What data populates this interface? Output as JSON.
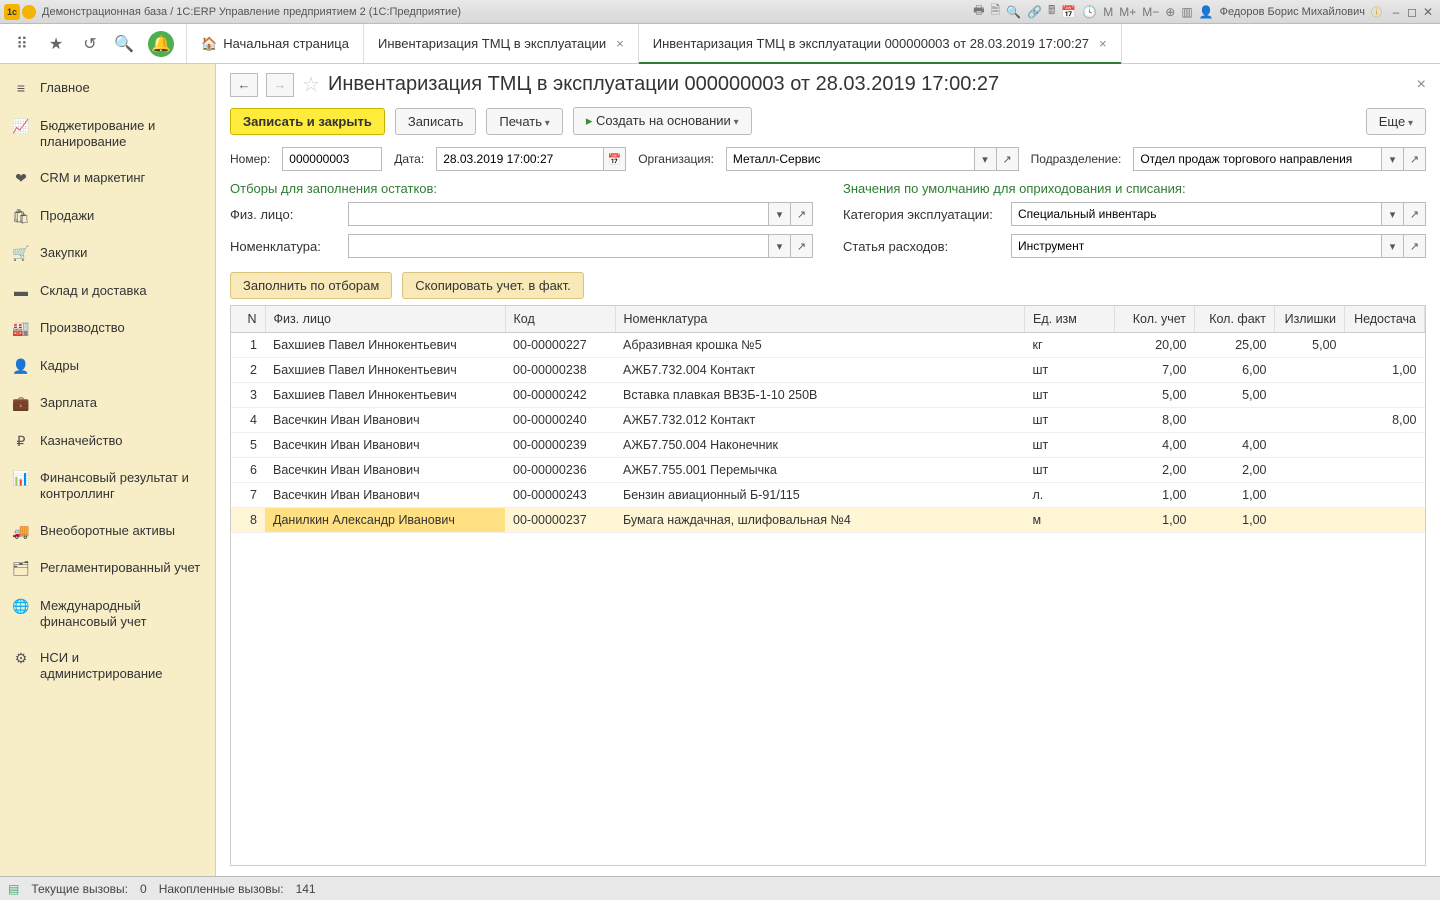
{
  "titlebar": {
    "title": "Демонстрационная база / 1C:ERP Управление предприятием 2  (1С:Предприятие)",
    "user": "Федоров Борис Михайлович",
    "m1": "M",
    "m2": "M+",
    "m3": "M−"
  },
  "tabs": {
    "home": "Начальная страница",
    "t1": "Инвентаризация ТМЦ в эксплуатации",
    "t2": "Инвентаризация ТМЦ в эксплуатации 000000003 от 28.03.2019 17:00:27"
  },
  "sidebar": [
    {
      "icon": "≡",
      "label": "Главное"
    },
    {
      "icon": "📈",
      "label": "Бюджетирование и планирование"
    },
    {
      "icon": "❤",
      "label": "CRM и маркетинг"
    },
    {
      "icon": "🛍",
      "label": "Продажи"
    },
    {
      "icon": "🛒",
      "label": "Закупки"
    },
    {
      "icon": "▬",
      "label": "Склад и доставка"
    },
    {
      "icon": "🏭",
      "label": "Производство"
    },
    {
      "icon": "👤",
      "label": "Кадры"
    },
    {
      "icon": "💼",
      "label": "Зарплата"
    },
    {
      "icon": "₽",
      "label": "Казначейство"
    },
    {
      "icon": "📊",
      "label": "Финансовый результат и контроллинг"
    },
    {
      "icon": "🚚",
      "label": "Внеоборотные активы"
    },
    {
      "icon": "🗂",
      "label": "Регламентированный учет"
    },
    {
      "icon": "🌐",
      "label": "Международный финансовый учет"
    },
    {
      "icon": "⚙",
      "label": "НСИ и администрирование"
    }
  ],
  "doc": {
    "title": "Инвентаризация ТМЦ в эксплуатации 000000003 от 28.03.2019 17:00:27",
    "save_close": "Записать и закрыть",
    "save": "Записать",
    "print": "Печать",
    "create_based": "Создать на основании",
    "more": "Еще"
  },
  "hdr": {
    "num_lbl": "Номер:",
    "num": "000000003",
    "date_lbl": "Дата:",
    "date": "28.03.2019 17:00:27",
    "org_lbl": "Организация:",
    "org": "Металл-Сервис",
    "dep_lbl": "Подразделение:",
    "dep": "Отдел продаж торгового направления"
  },
  "filters": {
    "title_left": "Отборы для заполнения остатков:",
    "title_right": "Значения по умолчанию для оприходования и списания:",
    "person_lbl": "Физ. лицо:",
    "person": "",
    "nom_lbl": "Номенклатура:",
    "nom": "",
    "cat_lbl": "Категория эксплуатации:",
    "cat": "Специальный инвентарь",
    "cost_lbl": "Статья расходов:",
    "cost": "Инструмент"
  },
  "sub": {
    "fill": "Заполнить по отборам",
    "copy": "Скопировать учет. в факт."
  },
  "cols": {
    "n": "N",
    "person": "Физ. лицо",
    "code": "Код",
    "nom": "Номенклатура",
    "unit": "Ед. изм",
    "q_acc": "Кол. учет",
    "q_fact": "Кол. факт",
    "surplus": "Излишки",
    "short": "Недостача"
  },
  "rows": [
    {
      "n": "1",
      "person": "Бахшиев Павел Иннокентьевич",
      "code": "00-00000227",
      "nom": "Абразивная крошка №5",
      "unit": "кг",
      "qa": "20,00",
      "qf": "25,00",
      "sur": "5,00",
      "sh": ""
    },
    {
      "n": "2",
      "person": "Бахшиев Павел Иннокентьевич",
      "code": "00-00000238",
      "nom": "АЖБ7.732.004 Контакт",
      "unit": "шт",
      "qa": "7,00",
      "qf": "6,00",
      "sur": "",
      "sh": "1,00"
    },
    {
      "n": "3",
      "person": "Бахшиев Павел Иннокентьевич",
      "code": "00-00000242",
      "nom": "Вставка плавкая ВВЗБ-1-10 250В",
      "unit": "шт",
      "qa": "5,00",
      "qf": "5,00",
      "sur": "",
      "sh": ""
    },
    {
      "n": "4",
      "person": "Васечкин Иван Иванович",
      "code": "00-00000240",
      "nom": "АЖБ7.732.012 Контакт",
      "unit": "шт",
      "qa": "8,00",
      "qf": "",
      "sur": "",
      "sh": "8,00"
    },
    {
      "n": "5",
      "person": "Васечкин Иван Иванович",
      "code": "00-00000239",
      "nom": "АЖБ7.750.004 Наконечник",
      "unit": "шт",
      "qa": "4,00",
      "qf": "4,00",
      "sur": "",
      "sh": ""
    },
    {
      "n": "6",
      "person": "Васечкин Иван Иванович",
      "code": "00-00000236",
      "nom": "АЖБ7.755.001 Перемычка",
      "unit": "шт",
      "qa": "2,00",
      "qf": "2,00",
      "sur": "",
      "sh": ""
    },
    {
      "n": "7",
      "person": "Васечкин Иван Иванович",
      "code": "00-00000243",
      "nom": "Бензин авиационный Б-91/115",
      "unit": "л.",
      "qa": "1,00",
      "qf": "1,00",
      "sur": "",
      "sh": ""
    },
    {
      "n": "8",
      "person": "Данилкин Александр Иванович",
      "code": "00-00000237",
      "nom": "Бумага наждачная, шлифовальная №4",
      "unit": "м",
      "qa": "1,00",
      "qf": "1,00",
      "sur": "",
      "sh": ""
    }
  ],
  "status": {
    "calls_lbl": "Текущие вызовы:",
    "calls": "0",
    "acc_lbl": "Накопленные вызовы:",
    "acc": "141"
  }
}
